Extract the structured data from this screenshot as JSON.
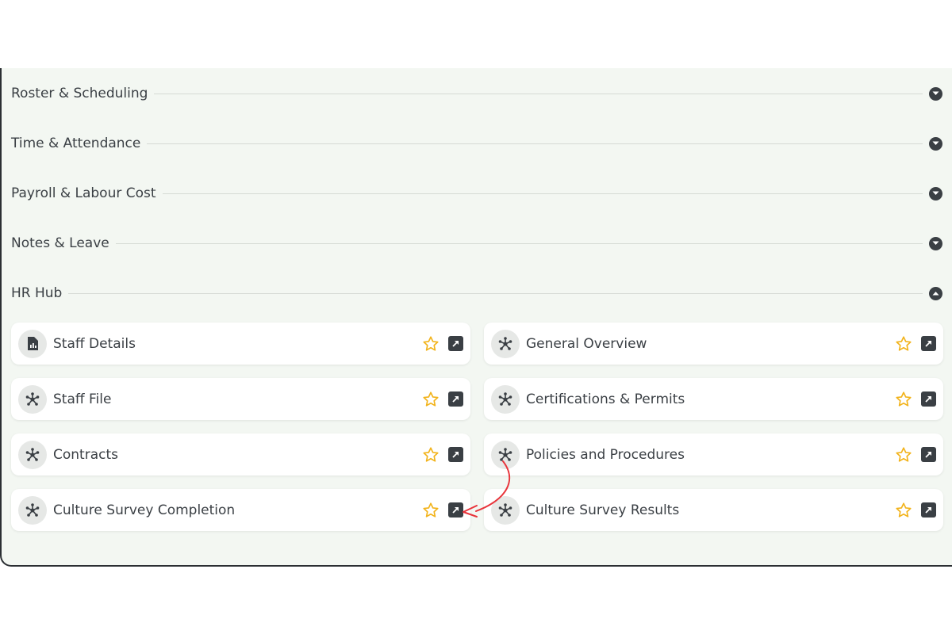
{
  "sections": [
    {
      "title": "Roster & Scheduling",
      "state": "collapsed",
      "icon": "chevron-down-icon"
    },
    {
      "title": "Time & Attendance",
      "state": "collapsed",
      "icon": "chevron-down-icon"
    },
    {
      "title": "Payroll & Labour Cost",
      "state": "collapsed",
      "icon": "chevron-down-icon"
    },
    {
      "title": "Notes & Leave",
      "state": "collapsed",
      "icon": "chevron-down-icon"
    },
    {
      "title": "HR Hub",
      "state": "expanded",
      "icon": "chevron-up-icon"
    }
  ],
  "hr_hub": {
    "cards": [
      {
        "label": "Staff Details",
        "icon": "report-icon"
      },
      {
        "label": "General Overview",
        "icon": "network-icon"
      },
      {
        "label": "Staff File",
        "icon": "network-icon"
      },
      {
        "label": "Certifications & Permits",
        "icon": "network-icon"
      },
      {
        "label": "Contracts",
        "icon": "network-icon"
      },
      {
        "label": "Policies and Procedures",
        "icon": "network-icon"
      },
      {
        "label": "Culture Survey Completion",
        "icon": "network-icon"
      },
      {
        "label": "Culture Survey Results",
        "icon": "network-icon"
      }
    ]
  },
  "colors": {
    "panel_bg": "#f3f7f2",
    "text": "#3a3f44",
    "star": "#f2b31b",
    "annotation_arrow": "#e8333a"
  }
}
